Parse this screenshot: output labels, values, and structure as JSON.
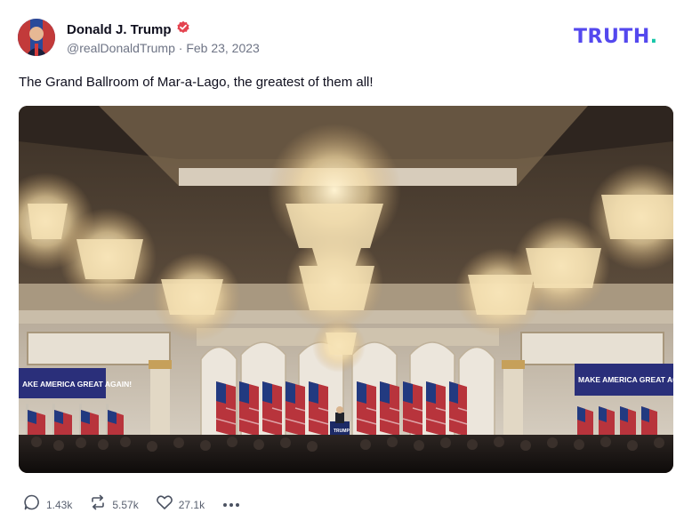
{
  "post": {
    "author": {
      "name": "Donald J. Trump",
      "handle": "@realDonaldTrump",
      "date": "Feb 23, 2023",
      "verified": true
    },
    "text": "The Grand Ballroom of Mar-a-Lago, the greatest of them all!",
    "image": {
      "description_icon": "photo-ballroom",
      "banner_left": "AKE AMERICA GREAT AGAIN!",
      "banner_right": "MAKE AMERICA GREAT AGAI",
      "podium_sign": "TRUMP"
    }
  },
  "brand": {
    "logo_text": "TRUTH",
    "logo_dot": "."
  },
  "actions": {
    "replies": "1.43k",
    "retruths": "5.57k",
    "likes": "27.1k"
  },
  "colors": {
    "brand_purple": "#5448ee",
    "brand_teal": "#16c6a8",
    "verified_red": "#e4434f",
    "muted_text": "#6e7485"
  }
}
